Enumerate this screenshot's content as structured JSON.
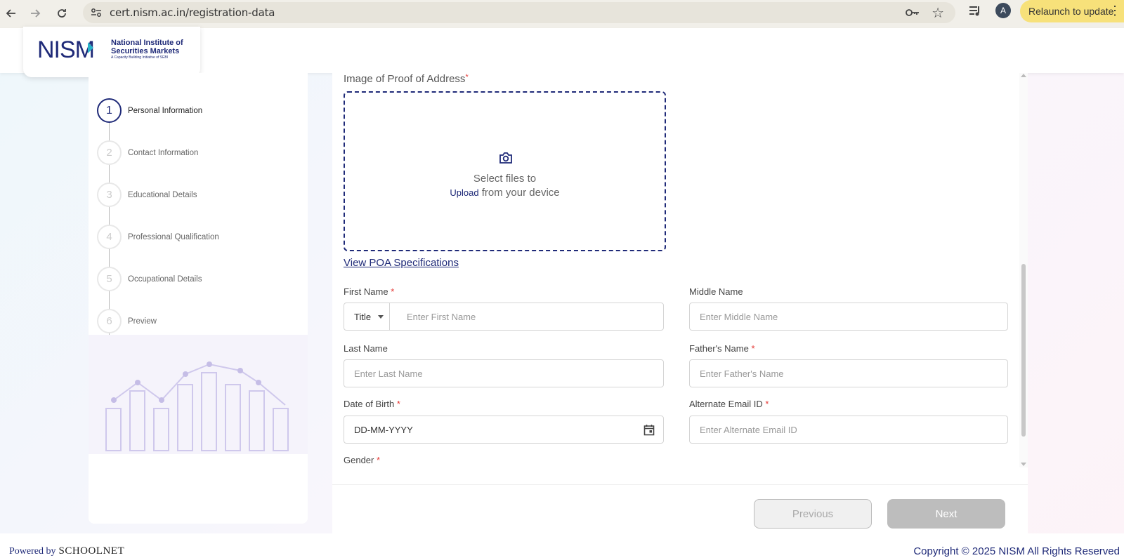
{
  "browser": {
    "url": "cert.nism.ac.in/registration-data",
    "avatar_letter": "A",
    "relaunch_label": "Relaunch to update"
  },
  "logo": {
    "mark": "NISM",
    "name": "National Institute of Securities Markets",
    "tagline": "A Capacity Building Initiative of SEBI"
  },
  "steps": [
    {
      "number": "1",
      "label": "Personal Information",
      "active": true
    },
    {
      "number": "2",
      "label": "Contact Information",
      "active": false
    },
    {
      "number": "3",
      "label": "Educational Details",
      "active": false
    },
    {
      "number": "4",
      "label": "Professional Qualification",
      "active": false
    },
    {
      "number": "5",
      "label": "Occupational Details",
      "active": false
    },
    {
      "number": "6",
      "label": "Preview",
      "active": false
    }
  ],
  "form": {
    "poa_label": "Image of Proof of Address",
    "upload_line1": "Select files to",
    "upload_link": "Upload",
    "upload_line2_rest": "from your device",
    "poa_specs_link": "View POA Specifications",
    "first_name_label": "First Name",
    "title_select_value": "Title",
    "first_name_placeholder": "Enter First Name",
    "middle_name_label": "Middle Name",
    "middle_name_placeholder": "Enter Middle Name",
    "last_name_label": "Last Name",
    "last_name_placeholder": "Enter Last Name",
    "fathers_name_label": "Father's Name",
    "fathers_name_placeholder": "Enter Father's Name",
    "dob_label": "Date of Birth",
    "dob_value": "DD-MM-YYYY",
    "alt_email_label": "Alternate Email ID",
    "alt_email_placeholder": "Enter Alternate Email ID",
    "gender_label": "Gender",
    "required_mark": "*"
  },
  "buttons": {
    "previous": "Previous",
    "next": "Next"
  },
  "footer": {
    "powered_by": "Powered by",
    "brand": "SCHOOLNET",
    "copyright": "Copyright © 2025 NISM All Rights Reserved"
  },
  "colors": {
    "brand_navy": "#1f2a78",
    "required_red": "#e53935",
    "relaunch_yellow": "#f7e17a"
  }
}
